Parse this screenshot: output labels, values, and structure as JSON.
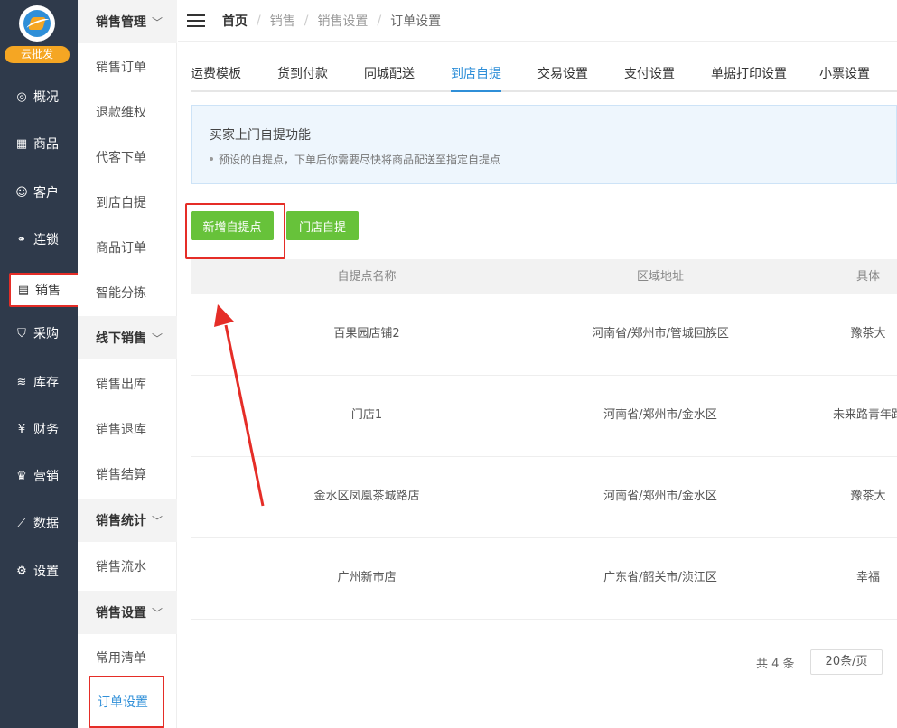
{
  "brand": {
    "name": "云批发"
  },
  "nav": [
    {
      "key": "overview",
      "label": "概况",
      "icon": "compass-icon",
      "glyph": "◎"
    },
    {
      "key": "goods",
      "label": "商品",
      "icon": "grid-icon",
      "glyph": "▦"
    },
    {
      "key": "customer",
      "label": "客户",
      "icon": "user-icon",
      "glyph": "☺"
    },
    {
      "key": "chain",
      "label": "连锁",
      "icon": "link-icon",
      "glyph": "⚭"
    },
    {
      "key": "sales",
      "label": "销售",
      "icon": "clipboard-icon",
      "glyph": "▤"
    },
    {
      "key": "purchase",
      "label": "采购",
      "icon": "basket-icon",
      "glyph": "⛉"
    },
    {
      "key": "stock",
      "label": "库存",
      "icon": "layers-icon",
      "glyph": "≋"
    },
    {
      "key": "finance",
      "label": "财务",
      "icon": "yen-icon",
      "glyph": "¥"
    },
    {
      "key": "marketing",
      "label": "营销",
      "icon": "crown-icon",
      "glyph": "♛"
    },
    {
      "key": "data",
      "label": "数据",
      "icon": "chart-icon",
      "glyph": "⟋"
    },
    {
      "key": "settings",
      "label": "设置",
      "icon": "gear-icon",
      "glyph": "⚙"
    }
  ],
  "submenu": {
    "groups": [
      {
        "label": "销售管理",
        "items": [
          "销售订单",
          "退款维权",
          "代客下单",
          "到店自提",
          "商品订单",
          "智能分拣"
        ]
      },
      {
        "label": "线下销售",
        "items": [
          "销售出库",
          "销售退库",
          "销售结算"
        ]
      },
      {
        "label": "销售统计",
        "items": [
          "销售流水"
        ]
      },
      {
        "label": "销售设置",
        "items": [
          "常用清单",
          "订单设置"
        ]
      }
    ],
    "chevron": "﹀"
  },
  "breadcrumb": [
    "首页",
    "销售",
    "销售设置",
    "订单设置"
  ],
  "tabs": [
    "运费模板",
    "货到付款",
    "同城配送",
    "到店自提",
    "交易设置",
    "支付设置",
    "单据打印设置",
    "小票设置"
  ],
  "notice": {
    "title": "买家上门自提功能",
    "desc": "预设的自提点，下单后你需要尽快将商品配送至指定自提点"
  },
  "buttons": {
    "add": "新增自提点",
    "store": "门店自提"
  },
  "table": {
    "headers": [
      "自提点名称",
      "区域地址",
      "具体"
    ],
    "rows": [
      [
        "百果园店铺2",
        "河南省/郑州市/管城回族区",
        "豫茶大"
      ],
      [
        "门店1",
        "河南省/郑州市/金水区",
        "未来路青年路"
      ],
      [
        "金水区凤凰茶城路店",
        "河南省/郑州市/金水区",
        "豫茶大"
      ],
      [
        "广州新市店",
        "广东省/韶关市/浈江区",
        "幸福"
      ]
    ]
  },
  "pager": {
    "total": "共 4 条",
    "size": "20条/页"
  },
  "colors": {
    "sidebar": "#2f3a4b",
    "accent": "#2f8fd8",
    "green": "#67c23a",
    "highlight": "#e52d27"
  }
}
